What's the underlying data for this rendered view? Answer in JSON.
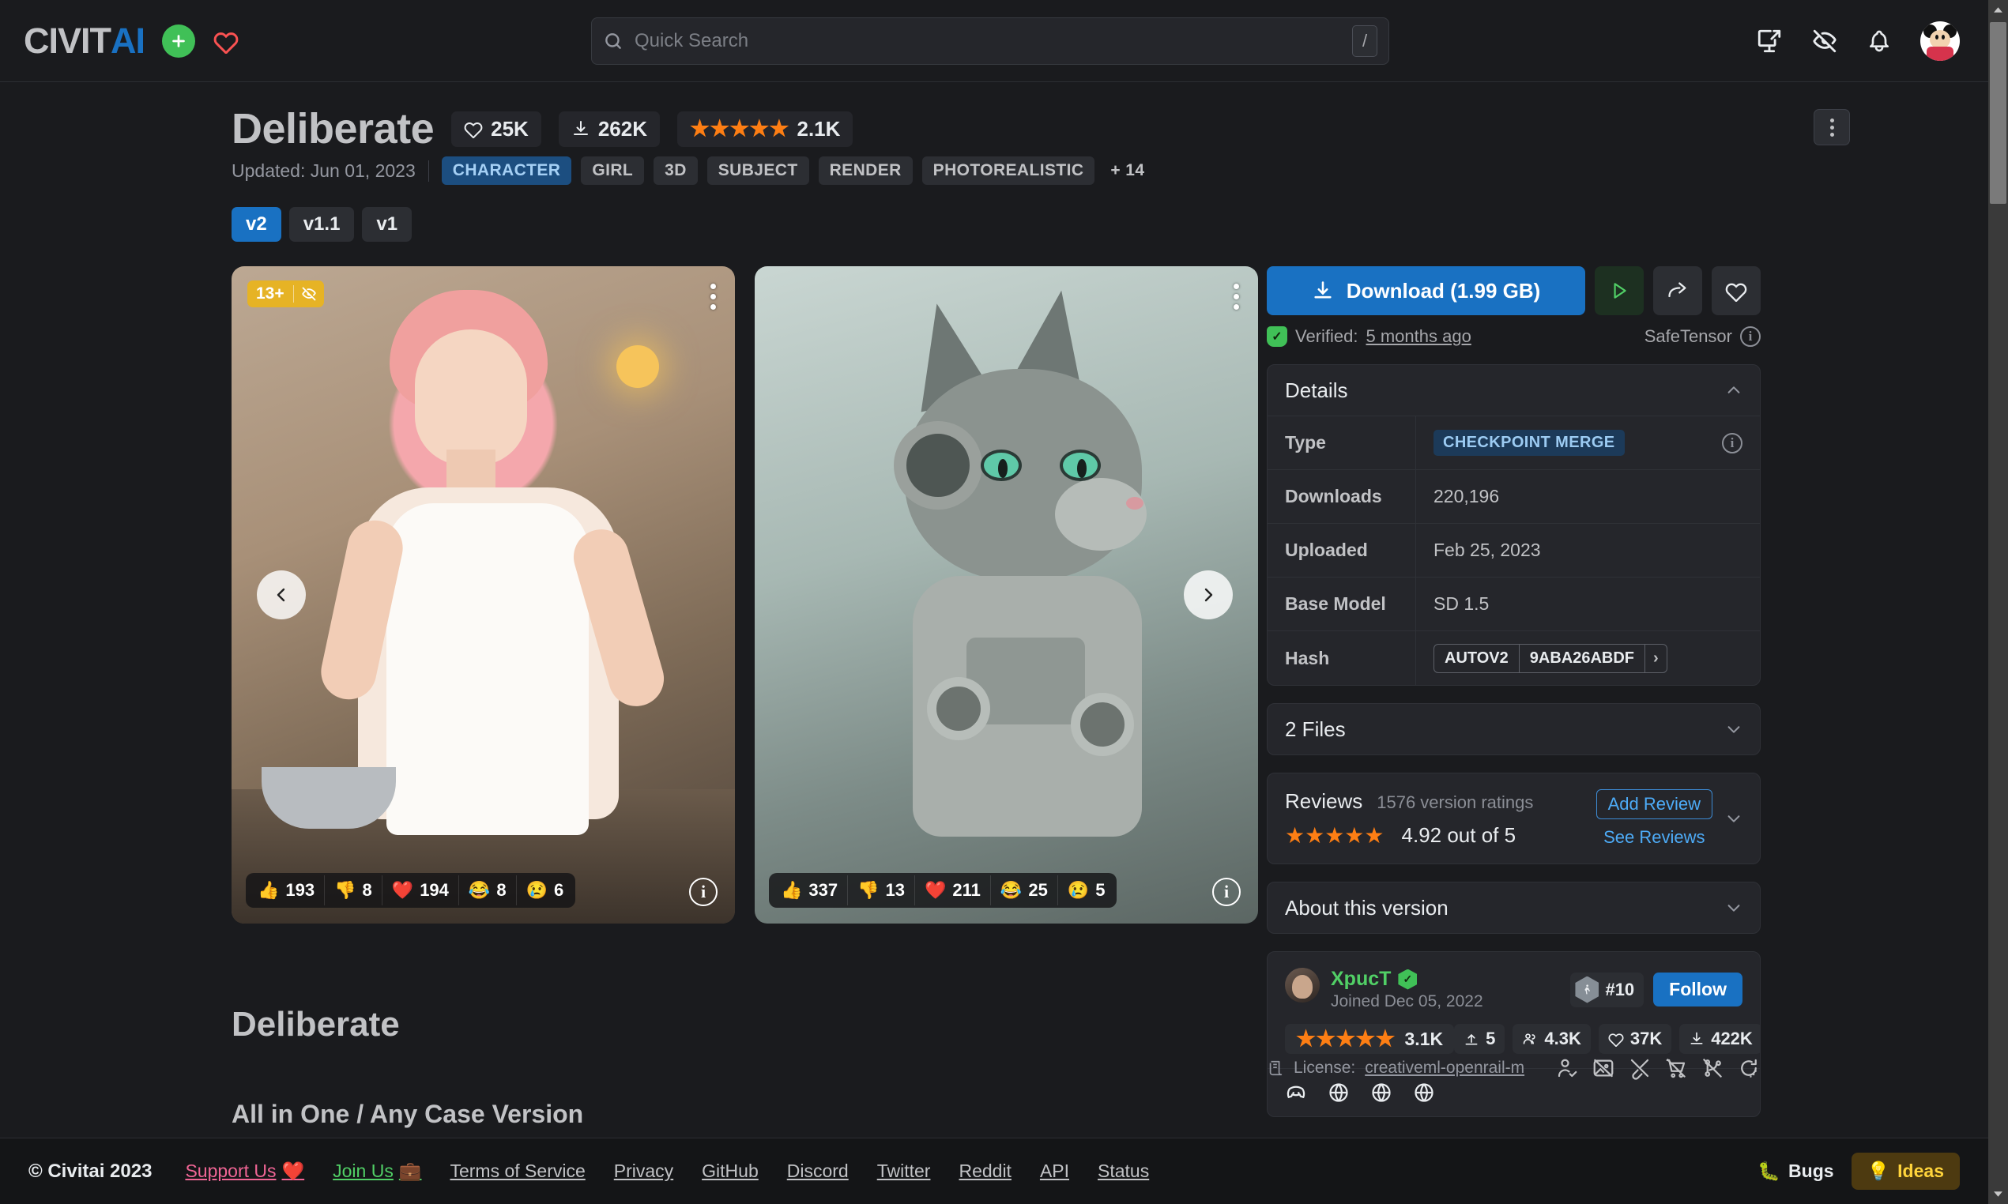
{
  "header": {
    "logo_civit": "CIVIT",
    "logo_ai": "AI",
    "create_icon": "plus-icon",
    "support_icon": "heart-icon",
    "search": {
      "placeholder": "Quick Search",
      "value": "",
      "shortcut": "/"
    },
    "icons": [
      "screen-share-icon",
      "eye-off-icon",
      "bell-icon"
    ],
    "avatar": "user-avatar"
  },
  "model": {
    "title": "Deliberate",
    "likes": "25K",
    "downloads_short": "262K",
    "rating_count": "2.1K",
    "stars_filled": 5,
    "updated": "Updated: Jun 01, 2023",
    "tags": [
      "CHARACTER",
      "GIRL",
      "3D",
      "SUBJECT",
      "RENDER",
      "PHOTOREALISTIC"
    ],
    "tags_more": "+ 14",
    "versions": [
      "v2",
      "v1.1",
      "v1"
    ],
    "active_version": "v2"
  },
  "gallery": {
    "nsfw_badge": "13+",
    "prev_label": "‹",
    "next_label": "›",
    "images": [
      {
        "name": "woman-in-kitchen-image",
        "reactions": [
          {
            "emoji": "👍",
            "count": "193",
            "name": "thumbs-up"
          },
          {
            "emoji": "👎",
            "count": "8",
            "name": "thumbs-down"
          },
          {
            "emoji": "❤️",
            "count": "194",
            "name": "heart"
          },
          {
            "emoji": "😂",
            "count": "8",
            "name": "laugh"
          },
          {
            "emoji": "😢",
            "count": "6",
            "name": "cry"
          }
        ]
      },
      {
        "name": "cyborg-cat-image",
        "reactions": [
          {
            "emoji": "👍",
            "count": "337",
            "name": "thumbs-up"
          },
          {
            "emoji": "👎",
            "count": "13",
            "name": "thumbs-down"
          },
          {
            "emoji": "❤️",
            "count": "211",
            "name": "heart"
          },
          {
            "emoji": "😂",
            "count": "25",
            "name": "laugh"
          },
          {
            "emoji": "😢",
            "count": "5",
            "name": "cry"
          }
        ]
      }
    ]
  },
  "description": {
    "heading": "Deliberate",
    "subheading": "All in One / Any Case Version"
  },
  "sidebar": {
    "download_label": "Download (1.99 GB)",
    "run_icon": "play-icon",
    "share_icon": "share-icon",
    "favorite_icon": "heart-icon",
    "verified_prefix": "Verified:",
    "verified_time": "5 months ago",
    "safetensor_label": "SafeTensor",
    "details": {
      "title": "Details",
      "rows": [
        {
          "key": "Type",
          "value": "CHECKPOINT MERGE",
          "style": "badge"
        },
        {
          "key": "Downloads",
          "value": "220,196",
          "style": "text"
        },
        {
          "key": "Uploaded",
          "value": "Feb 25, 2023",
          "style": "text"
        },
        {
          "key": "Base Model",
          "value": "SD 1.5",
          "style": "text"
        },
        {
          "key": "Hash",
          "value": "",
          "style": "hash"
        }
      ],
      "hash_algo": "AUTOV2",
      "hash_value": "9ABA26ABDF"
    },
    "files": {
      "title": "2 Files"
    },
    "reviews": {
      "title": "Reviews",
      "count_label": "1576 version ratings",
      "score_label": "4.92 out of 5",
      "stars_filled": 5,
      "add_review": "Add Review",
      "see_reviews": "See Reviews"
    },
    "about": {
      "title": "About this version"
    },
    "creator": {
      "username": "XpucT",
      "joined": "Joined Dec 05, 2022",
      "rank": "#10",
      "follow": "Follow",
      "rating": "3.1K",
      "stars_filled": 5,
      "metrics": [
        {
          "icon": "upload-icon",
          "value": "5"
        },
        {
          "icon": "users-icon",
          "value": "4.3K"
        },
        {
          "icon": "heart-icon",
          "value": "37K"
        },
        {
          "icon": "download-icon",
          "value": "422K"
        }
      ],
      "socials": [
        "discord-icon",
        "globe-icon",
        "globe-icon",
        "globe-icon"
      ]
    },
    "license": {
      "prefix": "License:",
      "name": "creativeml-openrail-m",
      "permission_icons": [
        "user-check-icon",
        "image-off-icon",
        "brush-off-icon",
        "cart-off-icon",
        "git-branch-off-icon",
        "rotate-off-icon"
      ]
    }
  },
  "footer": {
    "copyright": "© Civitai 2023",
    "links": [
      {
        "label": "Support Us",
        "emoji": "❤️",
        "style": "support"
      },
      {
        "label": "Join Us",
        "emoji": "💼",
        "style": "join"
      },
      {
        "label": "Terms of Service",
        "emoji": "",
        "style": ""
      },
      {
        "label": "Privacy",
        "emoji": "",
        "style": ""
      },
      {
        "label": "GitHub",
        "emoji": "",
        "style": ""
      },
      {
        "label": "Discord",
        "emoji": "",
        "style": ""
      },
      {
        "label": "Twitter",
        "emoji": "",
        "style": ""
      },
      {
        "label": "Reddit",
        "emoji": "",
        "style": ""
      },
      {
        "label": "API",
        "emoji": "",
        "style": ""
      },
      {
        "label": "Status",
        "emoji": "",
        "style": ""
      }
    ],
    "bugs": "Bugs",
    "bugs_emoji": "🐛",
    "ideas": "Ideas",
    "ideas_emoji": "💡"
  },
  "colors": {
    "background": "#1A1B1E",
    "panel": "#25262B",
    "accent_blue": "#1971C2",
    "link_blue": "#4DABF7",
    "green": "#40C057",
    "star_orange": "#FD7E14",
    "badge_yellow": "#E6B325"
  }
}
